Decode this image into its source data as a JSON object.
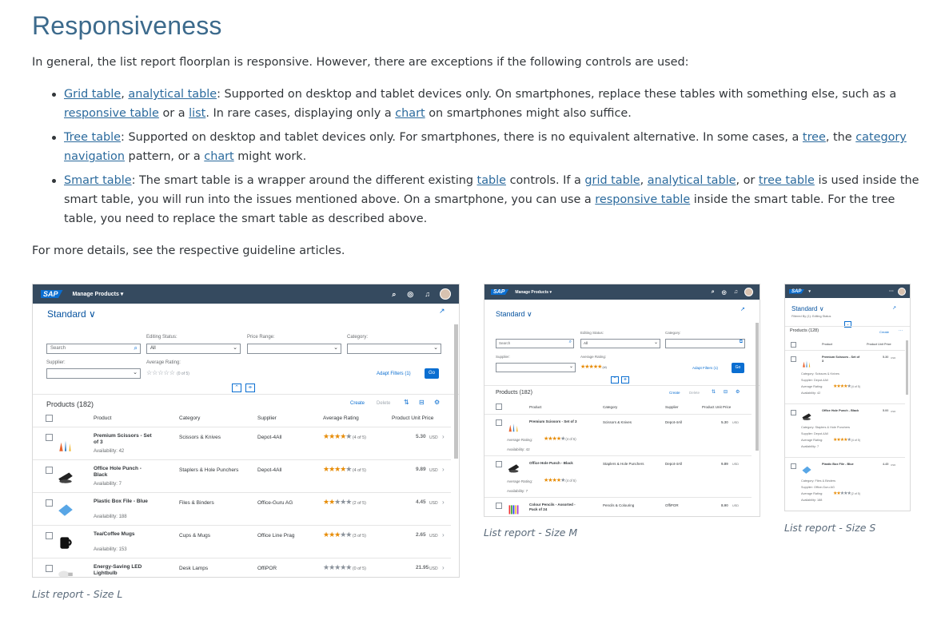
{
  "title": "Responsiveness",
  "intro": "In general, the list report floorplan is responsive. However, there are exceptions if the following controls are used:",
  "b1": {
    "l1": "Grid table",
    "s1": ", ",
    "l2": "analytical table",
    "t1": ": Supported on desktop and tablet devices only. On smartphones, replace these tables with something else, such as a ",
    "l3": "responsive table",
    "t2": " or a ",
    "l4": "list",
    "t3": ". In rare cases, displaying only a ",
    "l5": "chart",
    "t4": " on smartphones might also suffice."
  },
  "b2": {
    "l1": "Tree table",
    "t1": ": Supported on desktop and tablet devices only. For smartphones, there is no equivalent alternative. In some cases, a ",
    "l2": "tree",
    "t2": ", the ",
    "l3": "category navigation",
    "t3": " pattern, or a ",
    "l4": "chart",
    "t4": " might work."
  },
  "b3": {
    "l1": "Smart table",
    "t1": ": The smart table is a wrapper around the different existing ",
    "l2": "table",
    "t2": " controls. If a ",
    "l3": "grid table",
    "s1": ", ",
    "l4": "analytical table",
    "t3": ", or ",
    "l5": "tree table",
    "t4": " is used inside the smart table, you will run into the issues mentioned above. On a smartphone, you can use a ",
    "l6": "responsive table",
    "t5": " inside the smart table. For the tree table, you need to replace the smart table as described above."
  },
  "details": "For more details, see the respective guideline articles.",
  "captions": {
    "l": "List report - Size L",
    "m": "List report - Size M",
    "s": "List report - Size S"
  },
  "shotL": {
    "logo": "SAP",
    "app": "Manage Products ▾",
    "variant": "Standard ∨",
    "f_edit": "Editing Status:",
    "f_price": "Price Range:",
    "f_cat": "Category:",
    "search": "Search",
    "all": "All",
    "f_supplier": "Supplier:",
    "f_rating": "Average Rating:",
    "rating_ph": "(0 of 5)",
    "adapt": "Adapt Filters (1)",
    "go": "Go",
    "products": "Products (182)",
    "create": "Create",
    "delete": "Delete",
    "h_product": "Product",
    "h_category": "Category",
    "h_supplier": "Supplier",
    "h_rating": "Average Rating",
    "h_price": "Product Unit Price",
    "rows": [
      {
        "name": "Premium Scissors - Set of 3",
        "avail": "Availability: 42",
        "cat": "Scissors & Knives",
        "sup": "Depot-4All",
        "on": "★★★★",
        "off": "★",
        "rt": "(4 of 5)",
        "price": "5.30",
        "cur": "USD"
      },
      {
        "name": "Office Hole Punch - Black",
        "avail": "Availability: 7",
        "cat": "Staplers & Hole Punchers",
        "sup": "Depot-4All",
        "on": "★★★★",
        "off": "★",
        "rt": "(4 of 5)",
        "price": "9.89",
        "cur": "USD"
      },
      {
        "name": "Plastic Box File - Blue",
        "avail": "Availability: 188",
        "cat": "Files & Binders",
        "sup": "Office-Guru AG",
        "on": "★★",
        "off": "★★★",
        "rt": "(2 of 5)",
        "price": "4.45",
        "cur": "USD"
      },
      {
        "name": "Tea/Coffee Mugs",
        "avail": "Availability: 153",
        "cat": "Cups & Mugs",
        "sup": "Office Line Prag",
        "on": "★★★",
        "off": "★★",
        "rt": "(3 of 5)",
        "price": "2.65",
        "cur": "USD"
      },
      {
        "name": "Energy-Saving LED Lightbulb",
        "avail": "",
        "cat": "Desk Lamps",
        "sup": "OffiPOR",
        "on": "",
        "off": "★★★★★",
        "rt": "(0 of 5)",
        "price": "21.95",
        "cur": "USD"
      }
    ]
  },
  "shotM": {
    "logo": "SAP",
    "app": "Manage Products ▾",
    "variant": "Standard ∨",
    "f_edit": "Editing Status:",
    "f_cat": "Category:",
    "search": "Search",
    "all": "All",
    "f_supplier": "Supplier:",
    "f_rating": "Average Rating:",
    "rating_ph": "(0 of 5)",
    "adapt": "Adapt Filters (1)",
    "go": "Go",
    "products": "Products (182)",
    "create": "Create",
    "delete": "Delete",
    "h_product": "Product",
    "h_category": "Category",
    "h_supplier": "Supplier",
    "h_price": "Product Unit Price",
    "avg_label": "Average Rating:",
    "rows": [
      {
        "name": "Premium Scissors - Set of 3",
        "cat": "Scissors & Knives",
        "sup": "Depot-4All",
        "price": "5.30",
        "cur": "USD",
        "on": "★★★★",
        "off": "★",
        "rt": "(4 of 5)",
        "avail": "Availability: 42"
      },
      {
        "name": "Office Hole Punch - Black",
        "cat": "Staplers & Hole Punchers",
        "sup": "Depot-4All",
        "price": "9.89",
        "cur": "USD",
        "on": "★★★★",
        "off": "★",
        "rt": "(4 of 5)",
        "avail": "Availability: 7"
      },
      {
        "name": "Colour Pencils - Assorted - Pack of 24",
        "cat": "Pencils & Colouring",
        "sup": "OffiPOR",
        "price": "8.90",
        "cur": "USD"
      }
    ]
  },
  "shotS": {
    "logo": "SAP",
    "app": "▾",
    "variant": "Standard ∨",
    "filtered": "Filtered By (1): Editing Status",
    "products": "Products (128)",
    "create": "Create",
    "h_product": "Product",
    "h_price": "Product Unit Price",
    "rows": [
      {
        "name": "Premium Scissors - Set of 3",
        "price": "5.30",
        "cur": "USD",
        "cat": "Category: Scissors & Knives",
        "sup": "Supplier: Depot-4All",
        "avg": "Average Rating:",
        "on": "★★★★",
        "off": "★",
        "rt": "(4 of 5)",
        "avail": "Availability: 42"
      },
      {
        "name": "Office Hole Punch - Black",
        "price": "5.00",
        "cur": "USD",
        "cat": "Category: Staplers & Hole Punchers",
        "sup": "Supplier: Depot-4All",
        "avg": "Average Rating:",
        "on": "★★★★",
        "off": "★",
        "rt": "(4 of 5)",
        "avail": "Availability: 7"
      },
      {
        "name": "Plastic Box File - Blue",
        "price": "4.45",
        "cur": "USD",
        "cat": "Category: Files & Binders",
        "sup": "Supplier: Office-Guru AG",
        "avg": "Average Rating:",
        "on": "★★",
        "off": "★★★",
        "rt": "(2 of 5)",
        "avail": "Availability: 188"
      }
    ]
  }
}
